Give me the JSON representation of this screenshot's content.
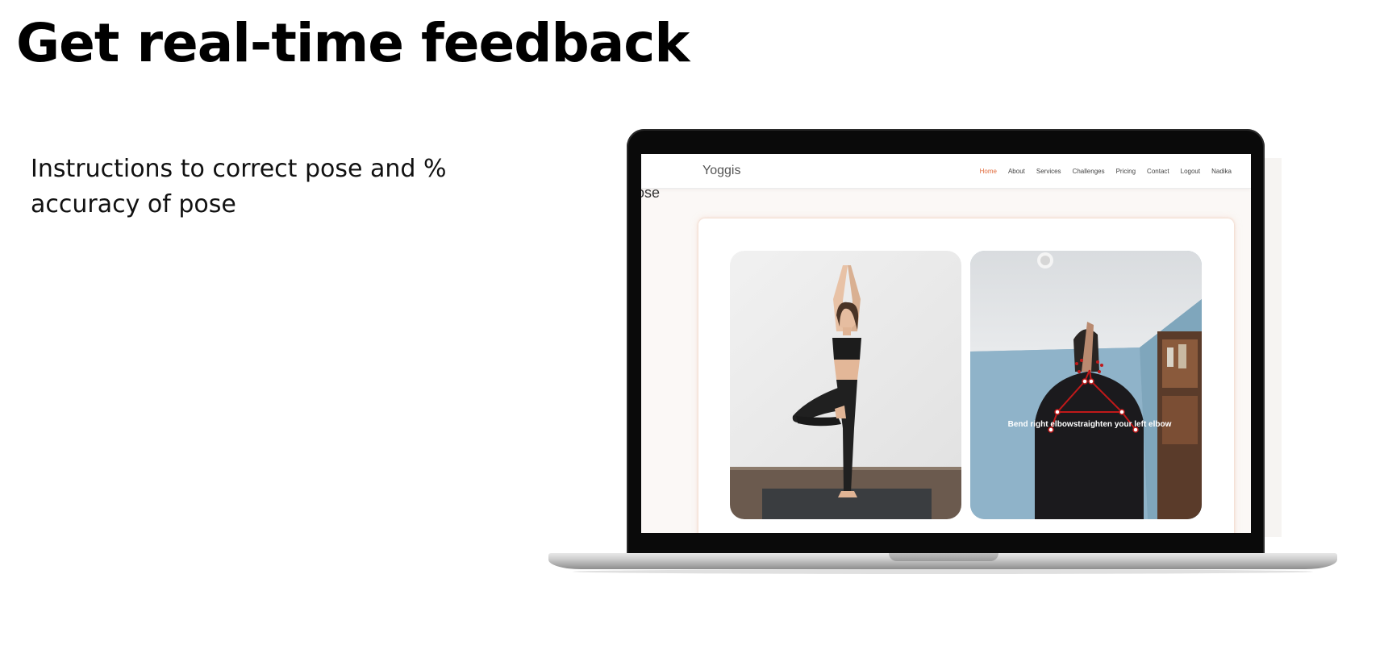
{
  "headline": "Get real-time feedback",
  "subtext": "Instructions to correct pose and % accuracy of pose",
  "site": {
    "brand": "Yoggis",
    "nav": [
      {
        "label": "Home",
        "active": true
      },
      {
        "label": "About",
        "active": false
      },
      {
        "label": "Services",
        "active": false
      },
      {
        "label": "Challenges",
        "active": false
      },
      {
        "label": "Pricing",
        "active": false
      },
      {
        "label": "Contact",
        "active": false
      },
      {
        "label": "Logout",
        "active": false
      },
      {
        "label": "Nadika",
        "active": false
      }
    ],
    "section_title_partial": "ose",
    "feedback_text": "Bend right elbowstraighten your left elbow",
    "accent_color": "#e06a3b"
  }
}
